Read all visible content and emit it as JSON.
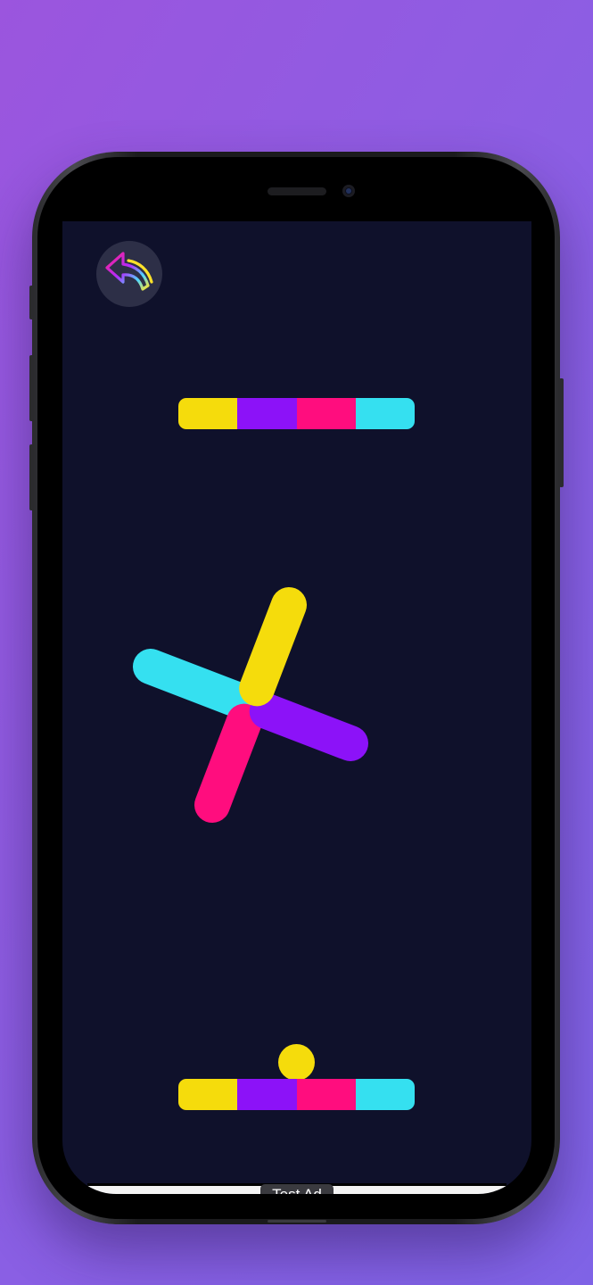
{
  "ad": {
    "label": "Test Ad"
  },
  "colors": {
    "background": "#0f112b",
    "yellow": "#f5dc0c",
    "purple": "#8c12f8",
    "pink": "#ff0d7e",
    "cyan": "#35e0f0",
    "back_button_bg": "#2d2f47"
  },
  "top_bar": {
    "segments": [
      "yellow",
      "purple",
      "pink",
      "cyan"
    ]
  },
  "bottom_bar": {
    "segments": [
      "yellow",
      "purple",
      "pink",
      "cyan"
    ]
  },
  "spinner": {
    "arms": [
      "yellow",
      "purple",
      "pink",
      "cyan"
    ]
  },
  "ball": {
    "color": "yellow"
  },
  "icons": {
    "back": "back-arrow-icon"
  }
}
